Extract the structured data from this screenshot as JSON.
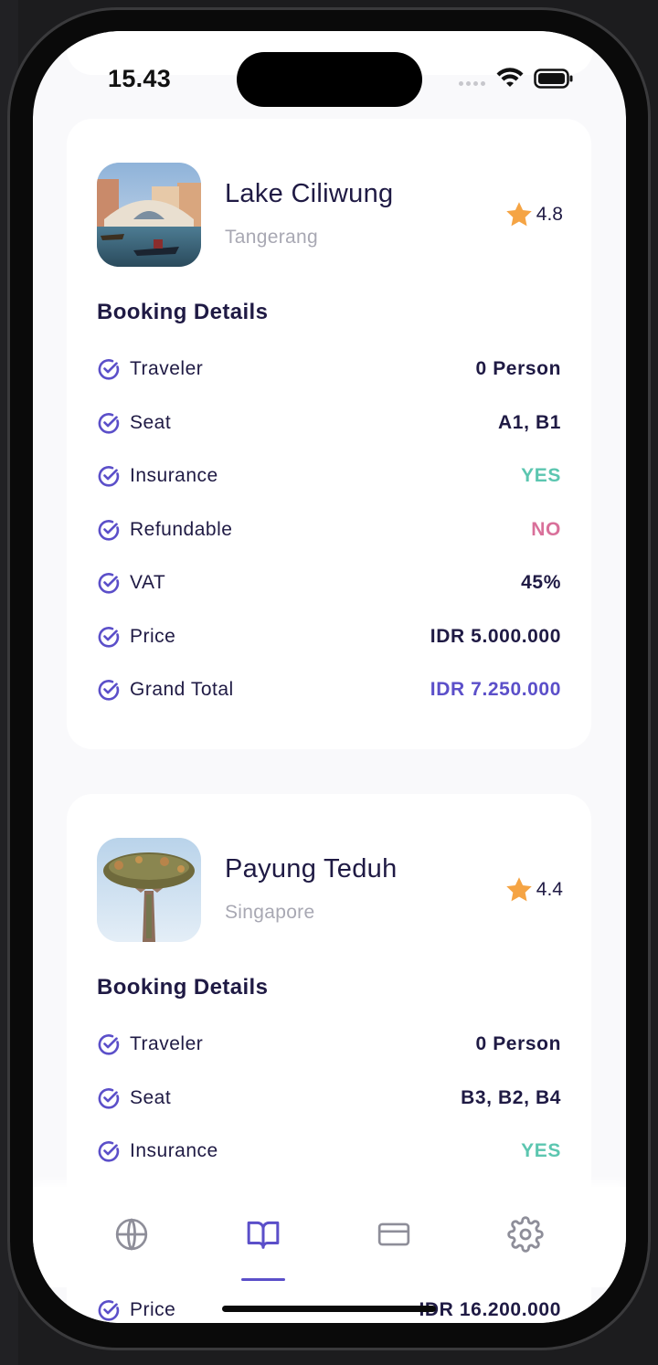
{
  "status": {
    "time": "15.43"
  },
  "bookings": [
    {
      "name": "Lake Ciliwung",
      "city": "Tangerang",
      "rating": "4.8",
      "section_title": "Booking Details",
      "details": [
        {
          "label": "Traveler",
          "value": "0 Person",
          "tone": "default"
        },
        {
          "label": "Seat",
          "value": "A1, B1",
          "tone": "default"
        },
        {
          "label": "Insurance",
          "value": "YES",
          "tone": "green"
        },
        {
          "label": "Refundable",
          "value": "NO",
          "tone": "pink"
        },
        {
          "label": "VAT",
          "value": "45%",
          "tone": "default"
        },
        {
          "label": "Price",
          "value": "IDR 5.000.000",
          "tone": "default"
        },
        {
          "label": "Grand Total",
          "value": "IDR 7.250.000",
          "tone": "purple"
        }
      ]
    },
    {
      "name": "Payung Teduh",
      "city": "Singapore",
      "rating": "4.4",
      "section_title": "Booking Details",
      "details": [
        {
          "label": "Traveler",
          "value": "0 Person",
          "tone": "default"
        },
        {
          "label": "Seat",
          "value": "B3, B2, B4",
          "tone": "default"
        },
        {
          "label": "Insurance",
          "value": "YES",
          "tone": "green"
        },
        {
          "label": "Price",
          "value": "IDR 16.200.000",
          "tone": "default"
        }
      ]
    }
  ],
  "tabbar": {
    "items": [
      {
        "icon": "globe-icon",
        "active": false
      },
      {
        "icon": "book-icon",
        "active": true
      },
      {
        "icon": "card-icon",
        "active": false
      },
      {
        "icon": "gear-icon",
        "active": false
      }
    ]
  },
  "colors": {
    "accent": "#5b4fc9",
    "text": "#1f1a44",
    "muted": "#a8a8b3",
    "success": "#5cc6b0",
    "danger": "#d9709a",
    "star": "#f5a444"
  }
}
